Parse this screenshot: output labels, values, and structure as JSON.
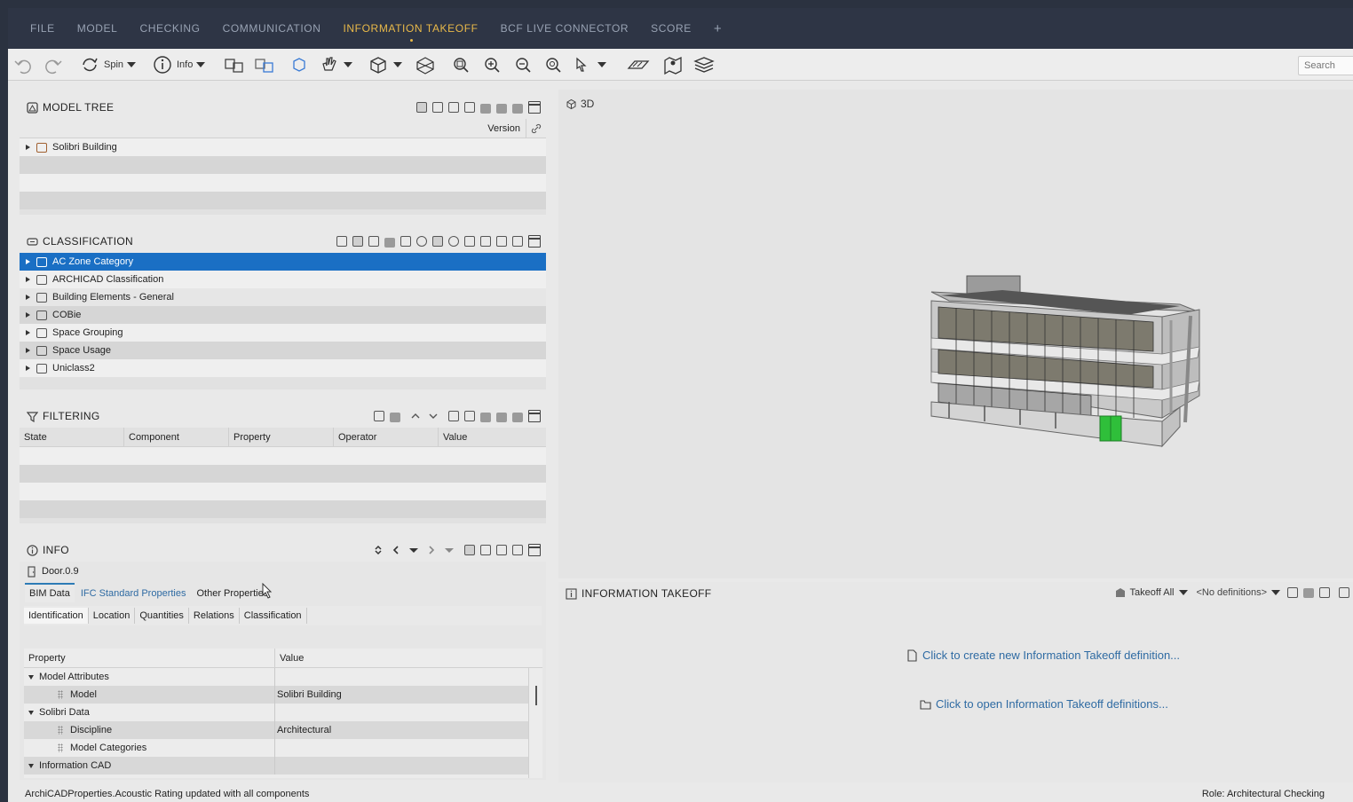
{
  "menu": {
    "items": [
      "FILE",
      "MODEL",
      "CHECKING",
      "COMMUNICATION",
      "INFORMATION TAKEOFF",
      "BCF LIVE CONNECTOR",
      "SCORE"
    ],
    "active": "INFORMATION TAKEOFF",
    "plus": "+"
  },
  "toolbar": {
    "spin_label": "Spin",
    "info_label": "Info",
    "search_placeholder": "Search"
  },
  "model_tree": {
    "title": "MODEL TREE",
    "version_col": "Version",
    "items": [
      "Solibri Building"
    ]
  },
  "classification": {
    "title": "CLASSIFICATION",
    "items": [
      "AC Zone Category",
      "ARCHICAD Classification",
      "Building Elements - General",
      "COBie",
      "Space Grouping",
      "Space Usage",
      "Uniclass2"
    ],
    "selected": "AC Zone Category"
  },
  "filtering": {
    "title": "FILTERING",
    "columns": [
      "State",
      "Component",
      "Property",
      "Operator",
      "Value"
    ]
  },
  "info": {
    "title": "INFO",
    "object": "Door.0.9",
    "tabs": [
      "BIM Data",
      "IFC Standard Properties",
      "Other Properties"
    ],
    "subtabs": [
      "Identification",
      "Location",
      "Quantities",
      "Relations",
      "Classification"
    ],
    "columns": [
      "Property",
      "Value"
    ],
    "rows": [
      {
        "type": "group",
        "property": "Model Attributes",
        "value": ""
      },
      {
        "type": "item",
        "property": "Model",
        "value": "Solibri Building"
      },
      {
        "type": "group",
        "property": "Solibri Data",
        "value": ""
      },
      {
        "type": "item",
        "property": "Discipline",
        "value": "Architectural"
      },
      {
        "type": "item",
        "property": "Model Categories",
        "value": ""
      },
      {
        "type": "group",
        "property": "Information CAD",
        "value": ""
      }
    ]
  },
  "view3d": {
    "label": "3D"
  },
  "info_takeoff": {
    "title": "INFORMATION TAKEOFF",
    "takeoff_all": "Takeoff All",
    "definitions": "<No definitions>",
    "create_link": "Click to create new Information Takeoff definition...",
    "open_link": "Click to open Information Takeoff definitions..."
  },
  "status": {
    "message": "ArchiCADProperties.Acoustic Rating updated with all components",
    "role": "Role: Architectural Checking"
  },
  "colors": {
    "accent": "#e9b949",
    "selection": "#1a6fc4",
    "link": "#2f6ba3",
    "menubar": "#2e3545",
    "door_green": "#2fbf3a"
  }
}
